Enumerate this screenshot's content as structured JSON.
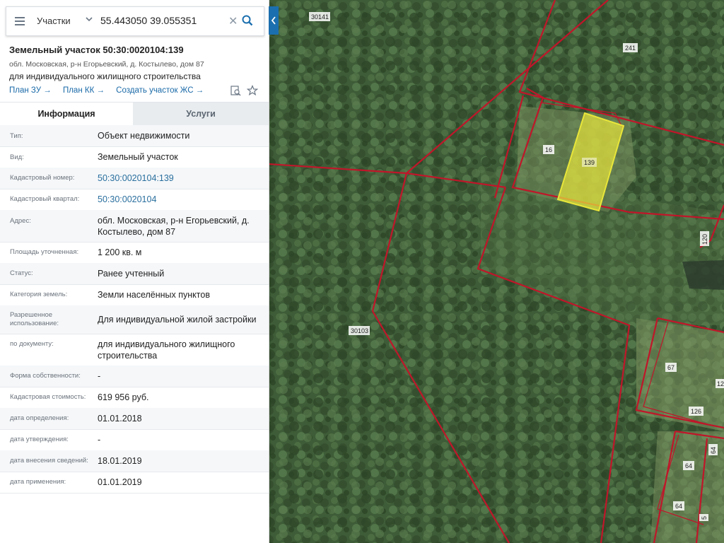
{
  "search": {
    "layer": "Участки",
    "query": "55.443050 39.055351"
  },
  "parcel": {
    "title": "Земельный участок 50:30:0020104:139",
    "address": "обл. Московская, р-н Егорьевский, д. Костылево, дом 87",
    "purpose": "для индивидуального жилищного строительства",
    "links": [
      "План ЗУ →",
      "План КК →",
      "Создать участок ЖС →"
    ]
  },
  "tabs": [
    "Информация",
    "Услуги"
  ],
  "info_rows": [
    {
      "label": "Тип:",
      "value": "Объект недвижимости"
    },
    {
      "label": "Вид:",
      "value": "Земельный участок"
    },
    {
      "label": "Кадастровый номер:",
      "value": "50:30:0020104:139"
    },
    {
      "label": "Кадастровый квартал:",
      "value": "50:30:0020104"
    },
    {
      "label": "Адрес:",
      "value": "обл. Московская, р-н Егорьевский, д. Костылево, дом 87"
    },
    {
      "label": "Площадь уточненная:",
      "value": "1 200 кв. м"
    },
    {
      "label": "Статус:",
      "value": "Ранее учтенный"
    },
    {
      "label": "Категория земель:",
      "value": "Земли населённых пунктов"
    },
    {
      "label": "Разрешенное использование:",
      "value": "Для индивидуальной жилой застройки"
    },
    {
      "label": "по документу:",
      "value": "для индивидуального жилищного строительства"
    },
    {
      "label": "Форма собственности:",
      "value": "-"
    },
    {
      "label": "Кадастровая стоимость:",
      "value": "619 956 руб."
    },
    {
      "label": "дата определения:",
      "value": "01.01.2018"
    },
    {
      "label": "дата утверждения:",
      "value": "-"
    },
    {
      "label": "дата внесения сведений:",
      "value": "18.01.2019"
    },
    {
      "label": "дата применения:",
      "value": "01.01.2019"
    }
  ],
  "map_labels": {
    "l30141": "30141",
    "l241": "241",
    "l16": "16",
    "l139": "139",
    "l120": "120",
    "l30103": "30103",
    "l67": "67",
    "l12": "12",
    "l126": "126",
    "l64a": "64",
    "l64b": "64",
    "l64c": "64",
    "l5": "5"
  },
  "colors": {
    "accent": "#1b6fae",
    "boundary": "#c0162a",
    "selected_parcel": "#e8e63a"
  }
}
